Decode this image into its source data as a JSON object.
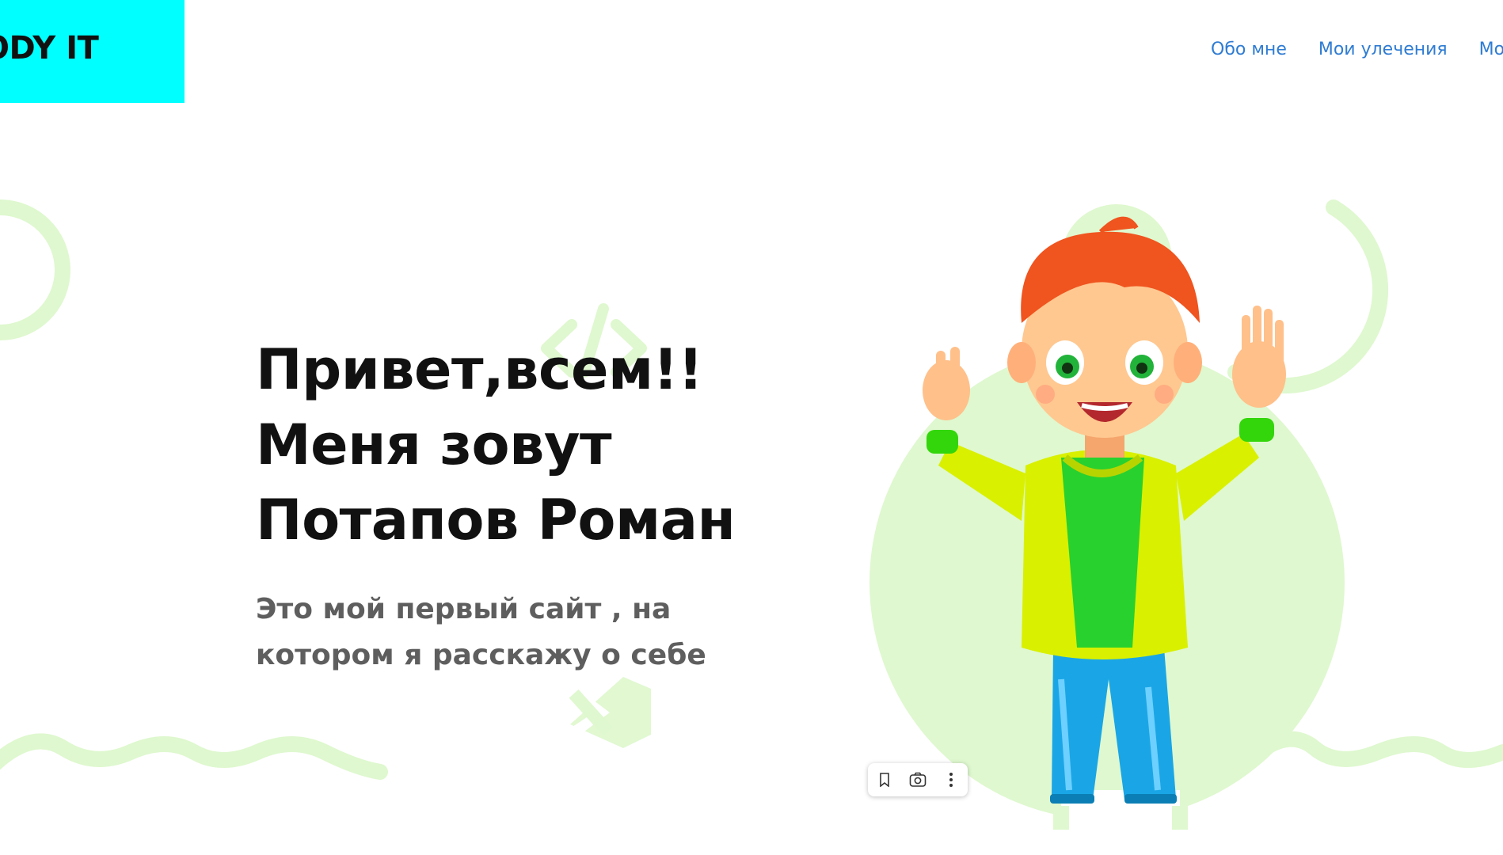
{
  "header": {
    "logo_text": "ODY IT",
    "nav": [
      {
        "label": "Обо мне"
      },
      {
        "label": "Мои улечения"
      },
      {
        "label": "Мои До"
      }
    ]
  },
  "hero": {
    "title_lines": [
      "Привет,всем!!",
      "Меня зовут",
      "Потапов Роман"
    ],
    "subtitle": "Это мой первый сайт , на котором я расскажу о себе"
  },
  "image_toolbar": {
    "icons": [
      "bookmark-icon",
      "lens-camera-icon",
      "more-vertical-icon"
    ]
  },
  "colors": {
    "logo_bg": "#00ffff",
    "nav_link": "#2f7cd3",
    "decor_green": "#d9f8c8",
    "title": "#111111",
    "subtitle": "#5e5e5e"
  }
}
